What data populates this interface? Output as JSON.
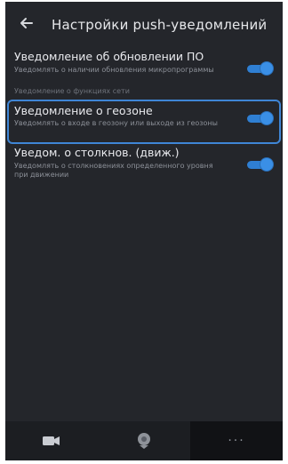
{
  "header": {
    "title": "Настройки push-уведомлений",
    "back_icon": "arrow-left-icon"
  },
  "settings": [
    {
      "title": "Уведомление об обновлении ПО",
      "description": "Уведомлять о наличии обновления микропрограммы",
      "sub": "Уведомление о функциях сети",
      "enabled": true
    },
    {
      "title": "Уведомление о геозоне",
      "description": "Уведомлять о входе в геозону или выходе из геозоны",
      "enabled": true
    },
    {
      "title": "Уведом. о столкнов. (движ.)",
      "description": "Уведомлять о столкновениях определенного уровня при движении",
      "enabled": true
    }
  ],
  "bottom_nav": [
    {
      "icon": "video-camera-icon"
    },
    {
      "icon": "map-pin-icon"
    },
    {
      "icon": "more-icon",
      "label": "···"
    }
  ],
  "colors": {
    "background": "#24262b",
    "accent": "#3a8fe6",
    "selection_border": "#3f86d6"
  }
}
